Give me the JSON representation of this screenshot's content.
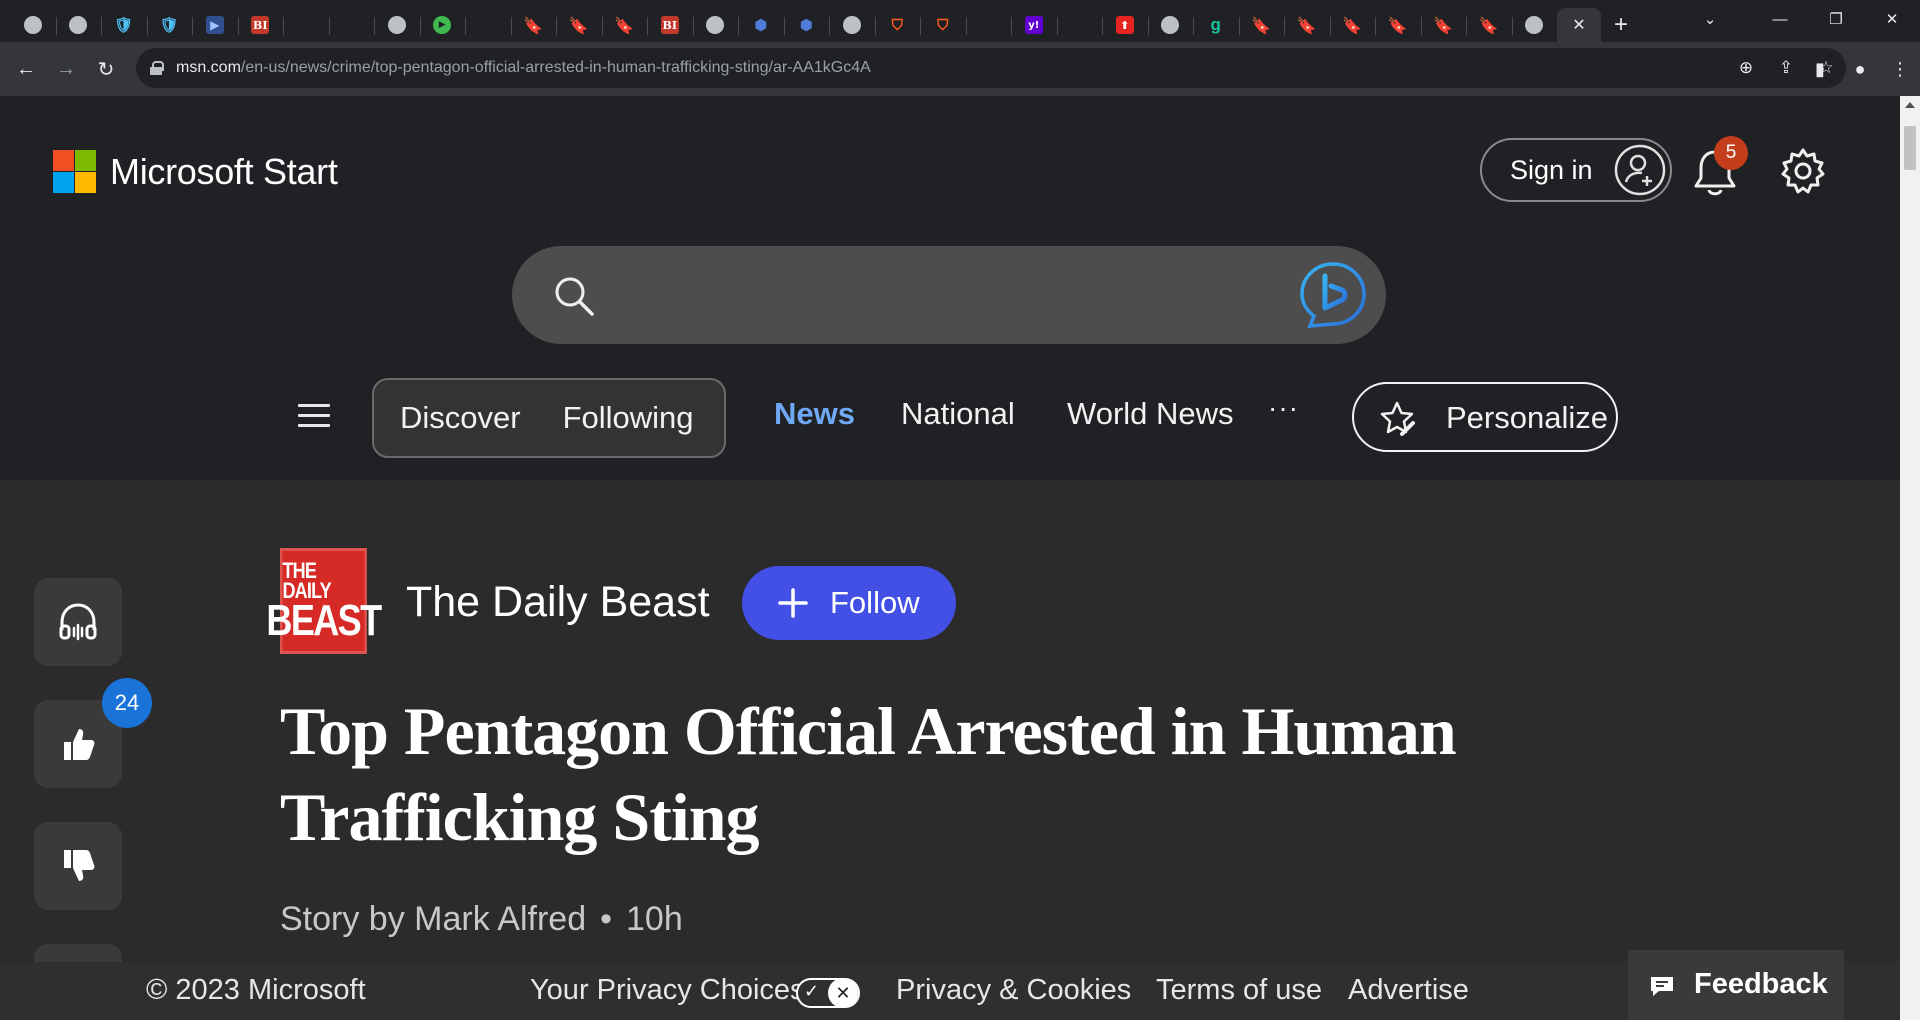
{
  "browser": {
    "tabs": [
      {
        "icon": "globe-icon",
        "glyph": ""
      },
      {
        "icon": "globe-icon",
        "glyph": ""
      },
      {
        "icon": "shield-icon",
        "glyph": "🛡"
      },
      {
        "icon": "shield-icon",
        "glyph": "🛡"
      },
      {
        "icon": "bookmark-blue-icon",
        "glyph": "▶"
      },
      {
        "icon": "business-insider-icon",
        "glyph": "BI"
      },
      {
        "icon": "search-icon",
        "glyph": "⌕"
      },
      {
        "icon": "search-icon",
        "glyph": "⌕"
      },
      {
        "icon": "globe-icon",
        "glyph": ""
      },
      {
        "icon": "play-icon",
        "glyph": "▶"
      },
      {
        "icon": "search-icon",
        "glyph": "⌕"
      },
      {
        "icon": "bookmark-orange-icon",
        "glyph": "🔖"
      },
      {
        "icon": "bookmark-orange-icon",
        "glyph": "🔖"
      },
      {
        "icon": "bookmark-orange-icon",
        "glyph": "🔖"
      },
      {
        "icon": "business-insider-icon",
        "glyph": "BI"
      },
      {
        "icon": "globe-icon",
        "glyph": ""
      },
      {
        "icon": "cube-icon",
        "glyph": "⬢"
      },
      {
        "icon": "cube-icon",
        "glyph": "⬢"
      },
      {
        "icon": "globe-icon",
        "glyph": ""
      },
      {
        "icon": "brave-icon",
        "glyph": "⛉"
      },
      {
        "icon": "brave-icon",
        "glyph": "⛉"
      },
      {
        "icon": "search-icon",
        "glyph": "⌕"
      },
      {
        "icon": "yahoo-icon",
        "glyph": "y!"
      },
      {
        "icon": "search-icon",
        "glyph": "⌕"
      },
      {
        "icon": "red-app-icon",
        "glyph": "⬆"
      },
      {
        "icon": "globe-icon",
        "glyph": ""
      },
      {
        "icon": "grammarly-icon",
        "glyph": "g"
      },
      {
        "icon": "bookmark-orange-icon",
        "glyph": "🔖"
      },
      {
        "icon": "bookmark-orange-icon",
        "glyph": "🔖"
      },
      {
        "icon": "bookmark-orange-icon",
        "glyph": "🔖"
      },
      {
        "icon": "bookmark-orange-icon",
        "glyph": "🔖"
      },
      {
        "icon": "bookmark-orange-icon",
        "glyph": "🔖"
      },
      {
        "icon": "bookmark-orange-icon",
        "glyph": "🔖"
      },
      {
        "icon": "globe-icon",
        "glyph": ""
      }
    ],
    "active_tab_close": "✕",
    "new_tab": "+",
    "url_host": "msn.com",
    "url_path": "/en-us/news/crime/top-pentagon-official-arrested-in-human-trafficking-sting/ar-AA1kGc4A"
  },
  "header": {
    "brand": "Microsoft Start",
    "sign_in": "Sign in",
    "notification_count": "5"
  },
  "search": {
    "placeholder": ""
  },
  "nav": {
    "pills": [
      "Discover",
      "Following"
    ],
    "links": [
      "News",
      "National",
      "World News"
    ],
    "active": "News",
    "more": "···",
    "personalize": "Personalize"
  },
  "rail": {
    "like_count": "24"
  },
  "article": {
    "source": "The Daily Beast",
    "logo_line1": "THE DAILY",
    "logo_line2": "BEAST",
    "follow": "Follow",
    "headline": "Top Pentagon Official Arrested in Human Trafficking Sting",
    "byline": "Story by Mark Alfred",
    "dot": "•",
    "age": "10h"
  },
  "footer": {
    "copyright": "© 2023 Microsoft",
    "privacy_choices": "Your Privacy Choices",
    "privacy_cookies": "Privacy & Cookies",
    "terms": "Terms of use",
    "advertise": "Advertise",
    "feedback": "Feedback"
  },
  "colors": {
    "accent_blue": "#6fa8f5",
    "follow_button": "#4350e6",
    "badge_red": "#c43e1c",
    "like_badge": "#1a73d8",
    "daily_beast_red": "#d52a25"
  }
}
